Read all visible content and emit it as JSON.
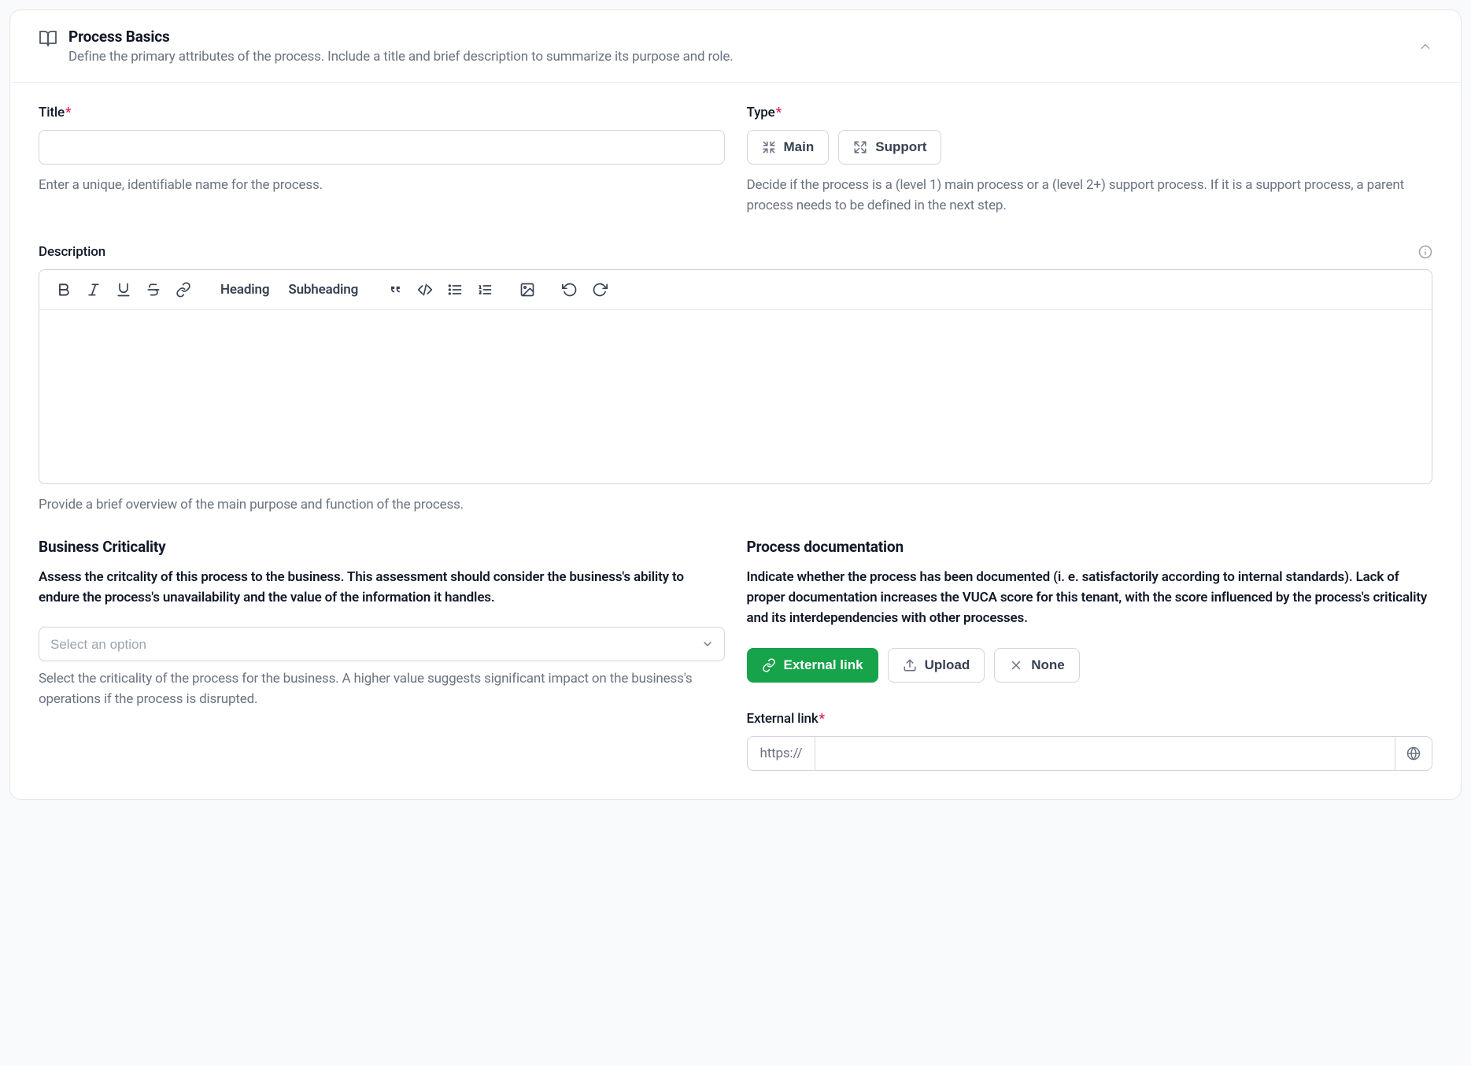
{
  "header": {
    "title": "Process Basics",
    "subtitle": "Define the primary attributes of the process. Include a title and brief description to summarize its purpose and role."
  },
  "title_field": {
    "label": "Title",
    "help": "Enter a unique, identifiable name for the process."
  },
  "type_field": {
    "label": "Type",
    "options": {
      "main": "Main",
      "support": "Support"
    },
    "help": "Decide if the process is a (level 1) main process or a (level 2+) support process. If it is a support process, a parent process needs to be defined in the next step."
  },
  "description_field": {
    "label": "Description",
    "toolbar": {
      "heading": "Heading",
      "subheading": "Subheading"
    },
    "help": "Provide a brief overview of the main purpose and function of the process."
  },
  "criticality": {
    "title": "Business Criticality",
    "desc": "Assess the critcality of this process to the business. This assessment should consider the business's ability to endure the process's unavailability and the value of the information it handles.",
    "placeholder": "Select an option",
    "help": "Select the criticality of the process for the business. A higher value suggests significant impact on the business's operations if the process is disrupted."
  },
  "documentation": {
    "title": "Process documentation",
    "desc": "Indicate whether the process has been documented (i. e. satisfactorily according to internal standards). Lack of proper documentation increases the VUCA score for this tenant, with the score influenced by the process's criticality and its interdependencies with other processes.",
    "options": {
      "external": "External link",
      "upload": "Upload",
      "none": "None"
    },
    "external_label": "External link",
    "url_prefix": "https://"
  }
}
